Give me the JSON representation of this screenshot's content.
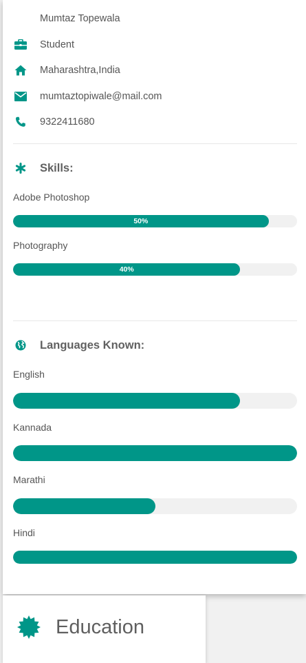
{
  "profile": {
    "name": "Mumtaz Topewala",
    "occupation": "Student",
    "location": "Maharashtra,India",
    "email": "mumtaztopiwale@mail.com",
    "phone": "9322411680"
  },
  "skills": {
    "title": "Skills:",
    "items": [
      {
        "label": "Adobe Photoshop",
        "percent_text": "50%",
        "displayed_fill": 0.9
      },
      {
        "label": "Photography",
        "percent_text": "40%",
        "displayed_fill": 0.8
      }
    ]
  },
  "languages": {
    "title": "Languages Known:",
    "items": [
      {
        "label": "English",
        "fill": 0.8
      },
      {
        "label": "Kannada",
        "fill": 1.0
      },
      {
        "label": "Marathi",
        "fill": 0.5
      },
      {
        "label": "Hindi",
        "fill": 1.0
      }
    ]
  },
  "education": {
    "title": "Education"
  },
  "colors": {
    "accent": "#009688",
    "track": "#f1f1f1",
    "text": "#616161"
  },
  "icons": [
    "briefcase-icon",
    "home-icon",
    "envelope-icon",
    "phone-icon",
    "asterisk-icon",
    "globe-icon",
    "badge-certificate-icon"
  ]
}
